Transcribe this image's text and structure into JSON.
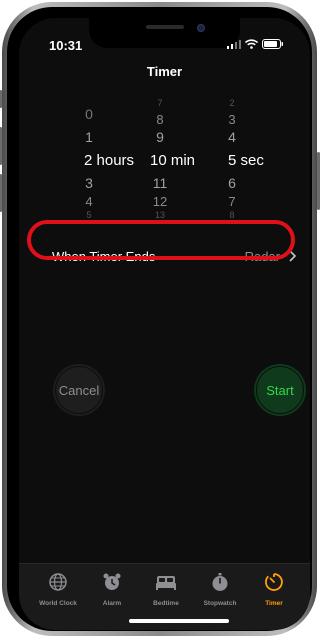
{
  "status": {
    "time": "10:31"
  },
  "nav": {
    "title": "Timer"
  },
  "picker": {
    "hours": {
      "above": [
        "0",
        "1"
      ],
      "selected": "2",
      "unit": "hours",
      "below": [
        "3",
        "4",
        "5"
      ]
    },
    "minutes": {
      "above": [
        "7",
        "8",
        "9"
      ],
      "selected": "10",
      "unit": "min",
      "below": [
        "11",
        "12",
        "13"
      ]
    },
    "seconds": {
      "above": [
        "2",
        "3",
        "4"
      ],
      "selected": "5",
      "unit": "sec",
      "below": [
        "6",
        "7",
        "8"
      ]
    }
  },
  "when_timer_ends": {
    "label": "When Timer Ends",
    "value": "Radar"
  },
  "buttons": {
    "cancel": "Cancel",
    "start": "Start"
  },
  "tabs": [
    {
      "label": "World Clock",
      "icon": "globe-icon",
      "active": false
    },
    {
      "label": "Alarm",
      "icon": "alarm-clock-icon",
      "active": false
    },
    {
      "label": "Bedtime",
      "icon": "bed-icon",
      "active": false
    },
    {
      "label": "Stopwatch",
      "icon": "stopwatch-icon",
      "active": false
    },
    {
      "label": "Timer",
      "icon": "timer-icon",
      "active": true
    }
  ],
  "colors": {
    "accent": "#ff9f0a",
    "start_text": "#32d74b",
    "highlight": "#e0101a"
  }
}
